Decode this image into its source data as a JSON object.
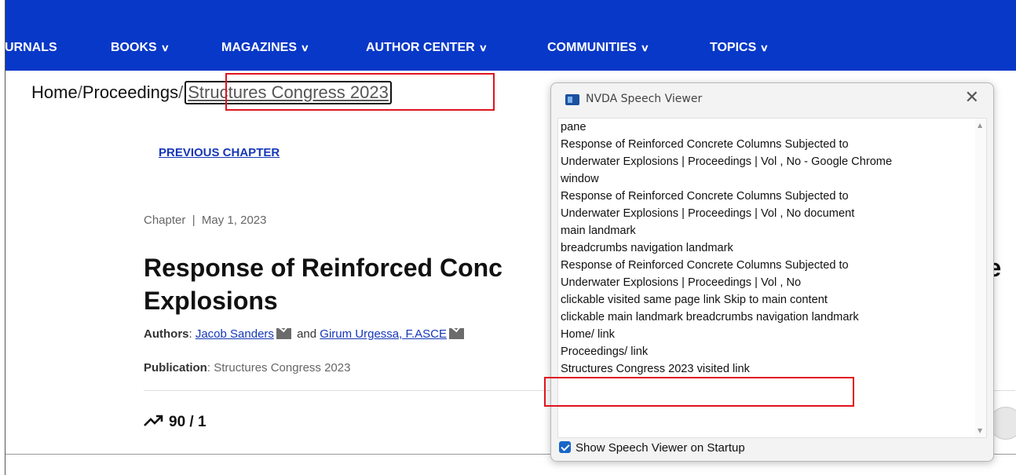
{
  "nav": {
    "items": [
      {
        "label": "URNALS",
        "chevron": false
      },
      {
        "label": "BOOKS",
        "chevron": true
      },
      {
        "label": "MAGAZINES",
        "chevron": true
      },
      {
        "label": "AUTHOR CENTER",
        "chevron": true
      },
      {
        "label": "COMMUNITIES",
        "chevron": true
      },
      {
        "label": "TOPICS",
        "chevron": true
      }
    ],
    "chevron_glyph": "∨"
  },
  "breadcrumb": {
    "home": "Home",
    "sep": "/",
    "proceedings": "Proceedings",
    "current": "Structures Congress 2023"
  },
  "article": {
    "previous_chapter": "PREVIOUS CHAPTER",
    "meta": "Chapter  |  May 1, 2023",
    "title_line1": "Response of Reinforced Conc",
    "title_line1_tail": "de",
    "title_line2": "Explosions",
    "authors_label": "Authors",
    "author1": "Jacob Sanders",
    "and_text": "and",
    "author2": "Girum Urgessa, F.ASCE",
    "publication_label": "Publication",
    "publication_value": "Structures Congress 2023",
    "metrics": "90 / 1"
  },
  "nvda": {
    "title": "NVDA Speech Viewer",
    "close": "✕",
    "lines": [
      "pane",
      "Response of Reinforced Concrete Columns Subjected to",
      "Underwater Explosions | Proceedings | Vol , No - Google Chrome",
      "window",
      "Response of Reinforced Concrete Columns Subjected to",
      "Underwater Explosions | Proceedings | Vol , No  document",
      "main landmark",
      "breadcrumbs  navigation landmark",
      "Response of Reinforced Concrete Columns Subjected to",
      "Underwater Explosions | Proceedings | Vol , No",
      "clickable  visited  same page  link   Skip to main content",
      "clickable  main landmark    breadcrumbs  navigation landmark",
      "Home/  link",
      "Proceedings/  link",
      "Structures Congress 2023  visited  link"
    ],
    "footer": "Show Speech Viewer on Startup",
    "footer_checked": true
  },
  "colors": {
    "nav_bg": "#0838c8",
    "link": "#1537b8",
    "highlight": "#e0141e"
  }
}
